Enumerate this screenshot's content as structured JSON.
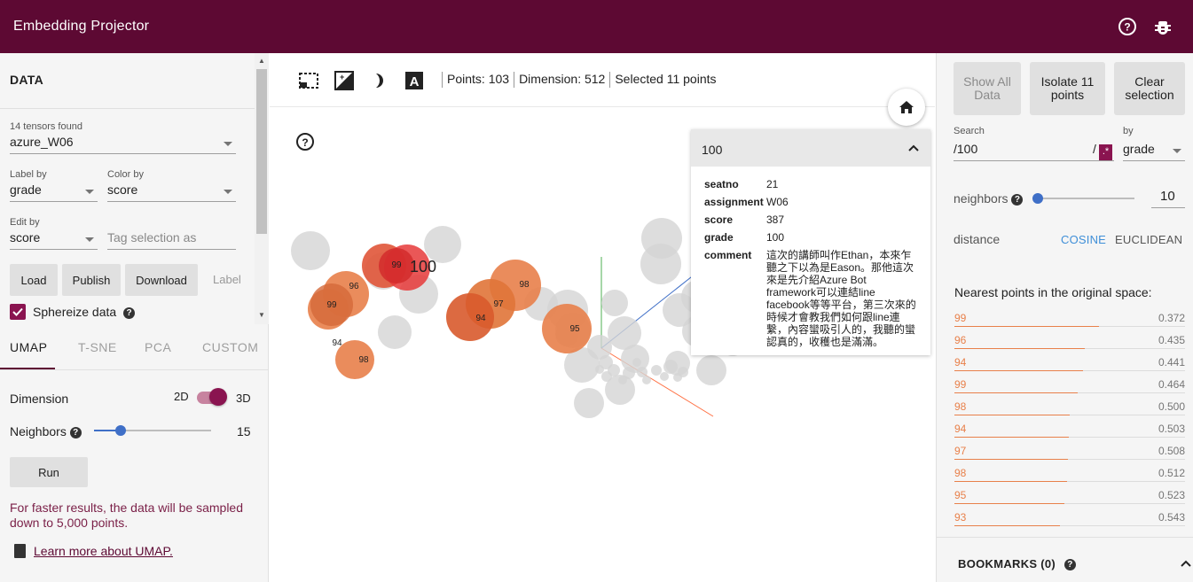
{
  "app": {
    "title": "Embedding Projector"
  },
  "left": {
    "section_title": "DATA",
    "tensors_found": "14 tensors found",
    "tensor": "azure_W06",
    "label_by": {
      "label": "Label by",
      "value": "grade"
    },
    "color_by": {
      "label": "Color by",
      "value": "score"
    },
    "edit_by": {
      "label": "Edit by",
      "value": "score"
    },
    "tag_placeholder": "Tag selection as",
    "buttons": {
      "load": "Load",
      "publish": "Publish",
      "download": "Download",
      "label": "Label"
    },
    "sphereize": {
      "label": "Sphereize data",
      "checked": true
    },
    "tabs": [
      "UMAP",
      "T-SNE",
      "PCA",
      "CUSTOM"
    ],
    "active_tab": "UMAP",
    "dimension": {
      "label": "Dimension",
      "opt_2d": "2D",
      "opt_3d": "3D",
      "value": "3D"
    },
    "neighbors": {
      "label": "Neighbors",
      "value": "15"
    },
    "run": "Run",
    "note": "For faster results, the data will be sampled down to 5,000 points.",
    "learn_more": "Learn more about UMAP."
  },
  "toolbar": {
    "points": "Points: 103",
    "dimension": "Dimension: 512",
    "selected": "Selected 11 points"
  },
  "plot": {
    "selected_label": "100",
    "point_labels": [
      "99",
      "96",
      "99",
      "94",
      "98",
      "97",
      "94",
      "98",
      "95"
    ]
  },
  "card": {
    "title": "100",
    "fields": [
      {
        "key": "seatno",
        "value": "21"
      },
      {
        "key": "assignment",
        "value": "W06"
      },
      {
        "key": "score",
        "value": "387"
      },
      {
        "key": "grade",
        "value": "100"
      },
      {
        "key": "comment",
        "value": "這次的講師叫作Ethan，本來乍聽之下以為是Eason。那他這次來是先介紹Azure Bot framework可以連結line facebook等等平台，第三次來的時候才會教我們如何跟line連繫，內容蠻吸引人的，我聽的蠻認真的，收穫也是滿滿。"
      }
    ]
  },
  "right": {
    "show_all": "Show All Data",
    "isolate": "Isolate 11 points",
    "clear": "Clear selection",
    "search_label": "Search",
    "search_value": "/100",
    "search_slash": "/",
    "regex": ".*",
    "by_label": "by",
    "by_value": "grade",
    "neighbors_label": "neighbors",
    "neighbors_value": "10",
    "distance_label": "distance",
    "cosine": "COSINE",
    "euclidean": "EUCLIDEAN",
    "nearest_title": "Nearest points in the original space:",
    "nearest": [
      {
        "label": "99",
        "value": "0.372"
      },
      {
        "label": "96",
        "value": "0.435"
      },
      {
        "label": "94",
        "value": "0.441"
      },
      {
        "label": "99",
        "value": "0.464"
      },
      {
        "label": "98",
        "value": "0.500"
      },
      {
        "label": "94",
        "value": "0.503"
      },
      {
        "label": "97",
        "value": "0.508"
      },
      {
        "label": "98",
        "value": "0.512"
      },
      {
        "label": "95",
        "value": "0.523"
      },
      {
        "label": "93",
        "value": "0.543"
      }
    ],
    "bookmarks": "BOOKMARKS (0)"
  },
  "colors": {
    "header": "#5d0933",
    "accent": "#8a1450",
    "link": "#3f8fd8",
    "point_orange": "#e8804a",
    "point_red": "#d9302a"
  }
}
